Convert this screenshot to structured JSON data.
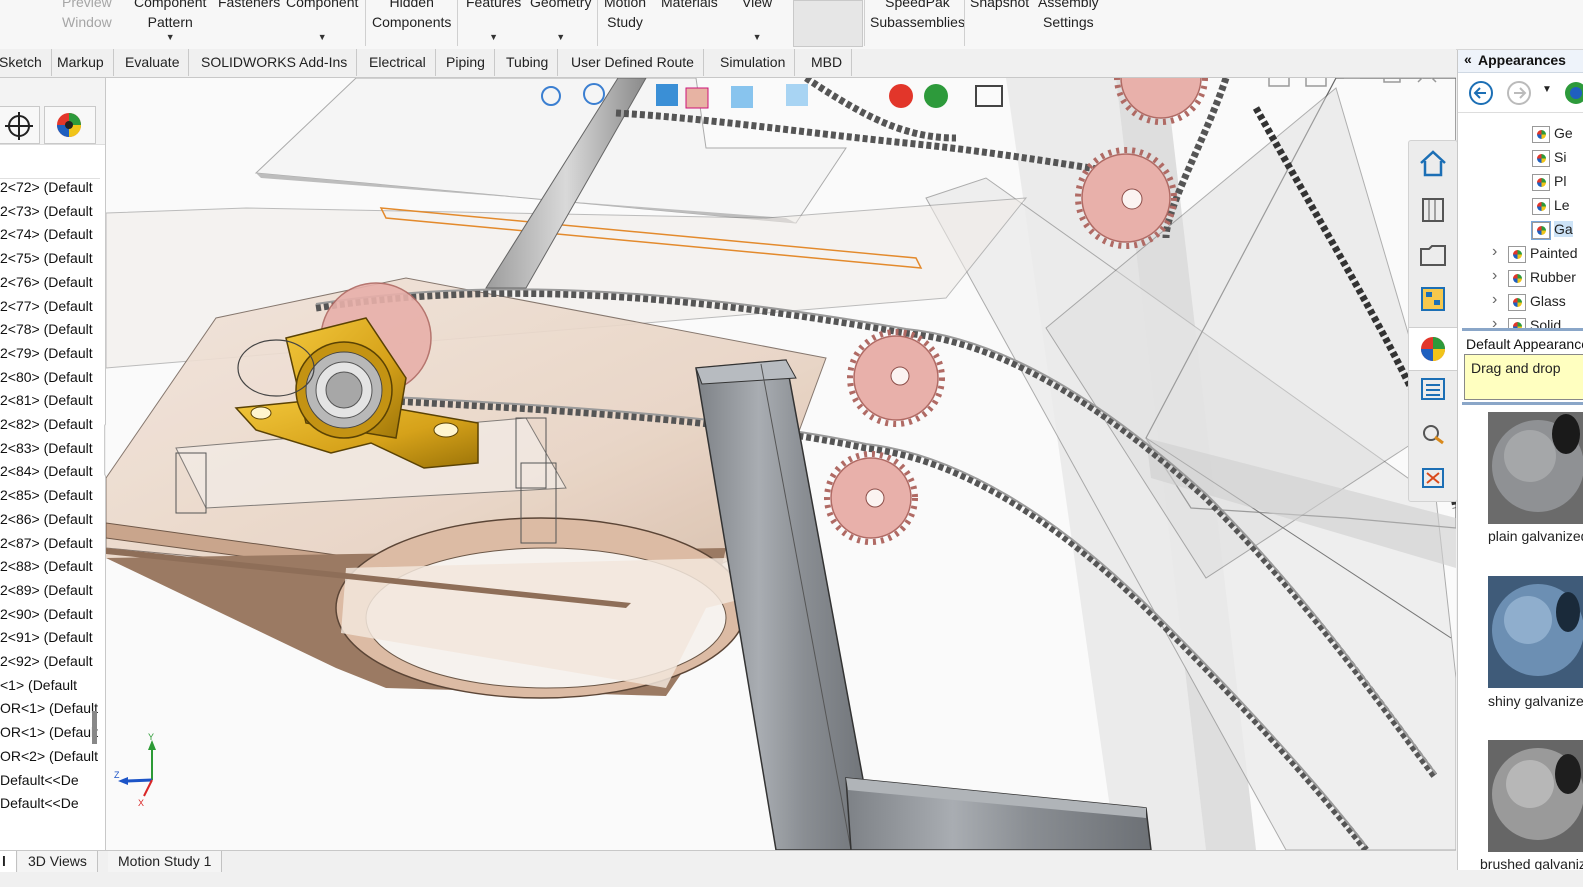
{
  "ribbon": {
    "preview_window": [
      "Preview",
      "Window"
    ],
    "component_pattern": [
      "Component",
      "Pattern"
    ],
    "fasteners": "Fasteners",
    "component": "Component",
    "hidden_components": [
      "Hidden",
      "Components"
    ],
    "features": "Features",
    "geometry": "Geometry",
    "motion_study": [
      "Motion",
      "Study"
    ],
    "materials": "Materials",
    "view": "View",
    "speedpak": [
      "SpeedPak",
      "Subassemblies"
    ],
    "snapshot": "Snapshot",
    "assembly_settings": [
      "Assembly",
      "Settings"
    ]
  },
  "tabs": [
    "Sketch",
    "Markup",
    "Evaluate",
    "SOLIDWORKS Add-Ins",
    "Electrical",
    "Piping",
    "Tubing",
    "User Defined Route",
    "Simulation",
    "MBD"
  ],
  "tree": {
    "items": [
      "2<72> (Default",
      "2<73> (Default",
      "2<74> (Default",
      "2<75> (Default",
      "2<76> (Default",
      "2<77> (Default",
      "2<78> (Default",
      "2<79> (Default",
      "2<80> (Default",
      "2<81> (Default",
      "2<82> (Default",
      "2<83> (Default",
      "2<84> (Default",
      "2<85> (Default",
      "2<86> (Default",
      "2<87> (Default",
      "2<88> (Default",
      "2<89> (Default",
      "2<90> (Default",
      "2<91> (Default",
      "2<92> (Default",
      "<1> (Default",
      "OR<1> (Default",
      "OR<1> (Default",
      "OR<2> (Default",
      "Default<<De",
      "Default<<De"
    ]
  },
  "appearances": {
    "title": "Appearances",
    "tree": [
      "Ge",
      "Si",
      "Pl",
      "Le",
      "Ga",
      "Painted",
      "Rubber",
      "Glass",
      "Solid"
    ],
    "default_label": "Default Appearance",
    "tooltip": "Drag and drop",
    "swatches": [
      "plain galvanized",
      "shiny galvanized",
      "brushed galvanized"
    ]
  },
  "bottom_tabs": [
    "l",
    "3D Views",
    "Motion Study 1"
  ],
  "colors": {
    "accent": "#1c6fb5",
    "tooltip_bg": "#ffffc0",
    "bearing": "#d6a21a",
    "sprocket": "#e8b0aa"
  }
}
